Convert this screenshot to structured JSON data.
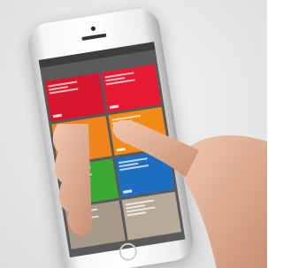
{
  "scene": {
    "background_color": "#e9e9e7",
    "phone_color": "#f4f4f4",
    "skin_color": "#e7b9a0",
    "app": {
      "statusbar_color": "#3e3e3e",
      "navbar_color": "#5b5b5b",
      "tiles": [
        {
          "color": "#d8162e"
        },
        {
          "color": "#e81a33"
        },
        {
          "color": "#f0831a"
        },
        {
          "color": "#f28c16"
        },
        {
          "color": "#3aaa35"
        },
        {
          "color": "#1f6fc0"
        },
        {
          "color": "#a79a8b"
        },
        {
          "color": "#b8aa98"
        }
      ]
    }
  }
}
